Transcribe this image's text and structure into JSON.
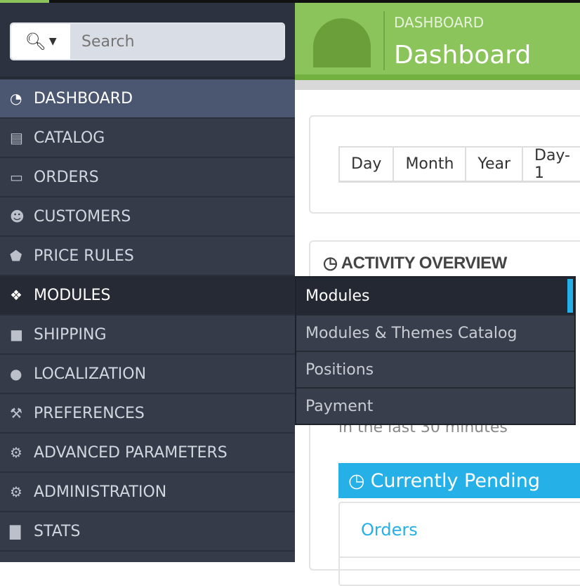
{
  "search": {
    "placeholder": "Search",
    "icon": "search-icon"
  },
  "sidebar": {
    "items": [
      {
        "label": "DASHBOARD",
        "icon": "dashboard-icon"
      },
      {
        "label": "CATALOG",
        "icon": "book-icon"
      },
      {
        "label": "ORDERS",
        "icon": "credit-card-icon"
      },
      {
        "label": "CUSTOMERS",
        "icon": "users-icon"
      },
      {
        "label": "PRICE RULES",
        "icon": "tags-icon"
      },
      {
        "label": "MODULES",
        "icon": "puzzle-icon"
      },
      {
        "label": "SHIPPING",
        "icon": "truck-icon"
      },
      {
        "label": "LOCALIZATION",
        "icon": "globe-icon"
      },
      {
        "label": "PREFERENCES",
        "icon": "wrench-icon"
      },
      {
        "label": "ADVANCED PARAMETERS",
        "icon": "cogs-icon"
      },
      {
        "label": "ADMINISTRATION",
        "icon": "cog-icon"
      },
      {
        "label": "STATS",
        "icon": "bar-chart-icon"
      }
    ]
  },
  "submenu": {
    "items": [
      {
        "label": "Modules"
      },
      {
        "label": "Modules & Themes Catalog"
      },
      {
        "label": "Positions"
      },
      {
        "label": "Payment"
      }
    ]
  },
  "header": {
    "breadcrumb": "DASHBOARD",
    "title": "Dashboard"
  },
  "period": {
    "buttons": [
      "Day",
      "Month",
      "Year",
      "Day-1"
    ]
  },
  "activity": {
    "title": "ACTIVITY OVERVIEW",
    "subtitle": "in the last 30 minutes",
    "pending_title": "Currently Pending",
    "orders_label": "Orders"
  },
  "colors": {
    "accent": "#25b0e7",
    "header_green": "#8bc45a",
    "sidebar": "#363b4a"
  }
}
